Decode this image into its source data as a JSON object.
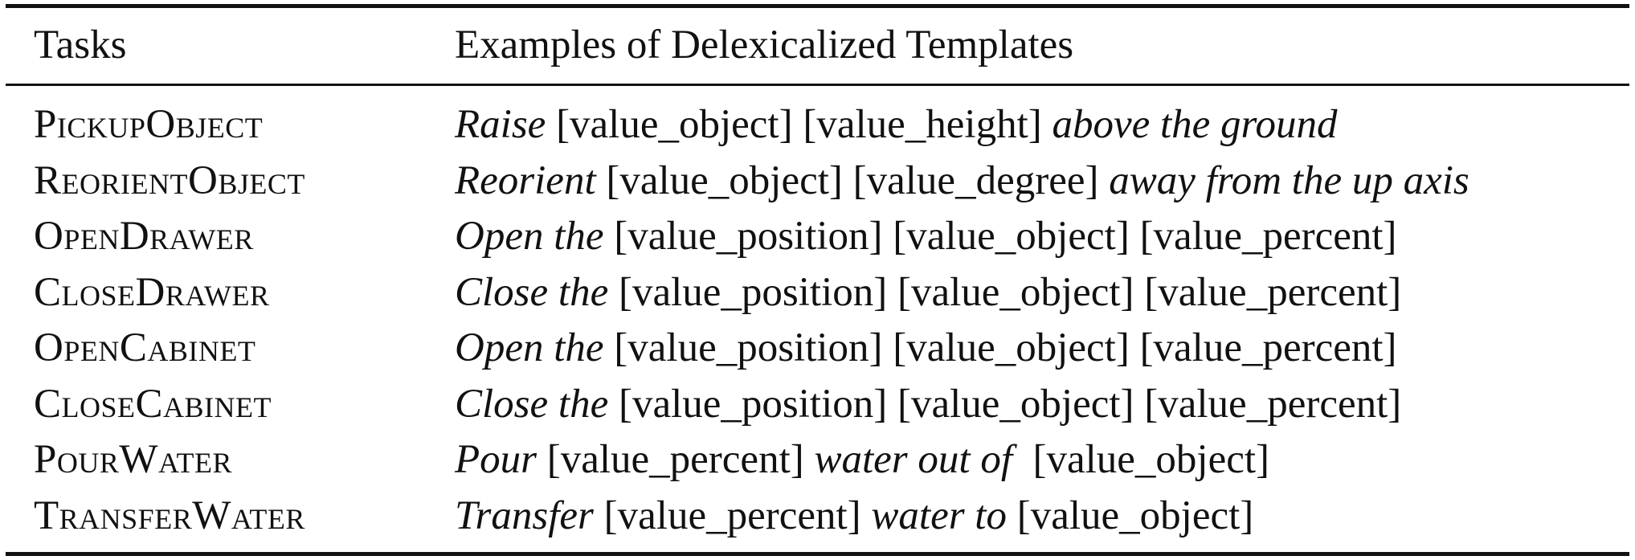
{
  "table": {
    "headers": {
      "tasks": "Tasks",
      "templates": "Examples of Delexicalized Templates"
    },
    "rows": [
      {
        "task": "PickupObject",
        "template": [
          {
            "text": "Raise",
            "italic": true
          },
          {
            "text": " [value_object] [value_height] ",
            "italic": false
          },
          {
            "text": "above the ground",
            "italic": true
          }
        ]
      },
      {
        "task": "ReorientObject",
        "template": [
          {
            "text": "Reorient",
            "italic": true
          },
          {
            "text": " [value_object] [value_degree] ",
            "italic": false
          },
          {
            "text": "away from the up axis",
            "italic": true
          }
        ]
      },
      {
        "task": "OpenDrawer",
        "template": [
          {
            "text": "Open the",
            "italic": true
          },
          {
            "text": " [value_position] [value_object] [value_percent]",
            "italic": false
          }
        ]
      },
      {
        "task": "CloseDrawer",
        "template": [
          {
            "text": "Close the",
            "italic": true
          },
          {
            "text": " [value_position] [value_object] [value_percent]",
            "italic": false
          }
        ]
      },
      {
        "task": "OpenCabinet",
        "template": [
          {
            "text": "Open the",
            "italic": true
          },
          {
            "text": " [value_position] [value_object] [value_percent]",
            "italic": false
          }
        ]
      },
      {
        "task": "CloseCabinet",
        "template": [
          {
            "text": "Close the",
            "italic": true
          },
          {
            "text": " [value_position] [value_object] [value_percent]",
            "italic": false
          }
        ]
      },
      {
        "task": "PourWater",
        "template": [
          {
            "text": "Pour",
            "italic": true
          },
          {
            "text": " [value_percent] ",
            "italic": false
          },
          {
            "text": "water out of",
            "italic": true
          },
          {
            "text": "  [value_object]",
            "italic": false
          }
        ]
      },
      {
        "task": "TransferWater",
        "template": [
          {
            "text": "Transfer",
            "italic": true
          },
          {
            "text": " [value_percent] ",
            "italic": false
          },
          {
            "text": "water to",
            "italic": true
          },
          {
            "text": " [value_object]",
            "italic": false
          }
        ]
      }
    ]
  }
}
